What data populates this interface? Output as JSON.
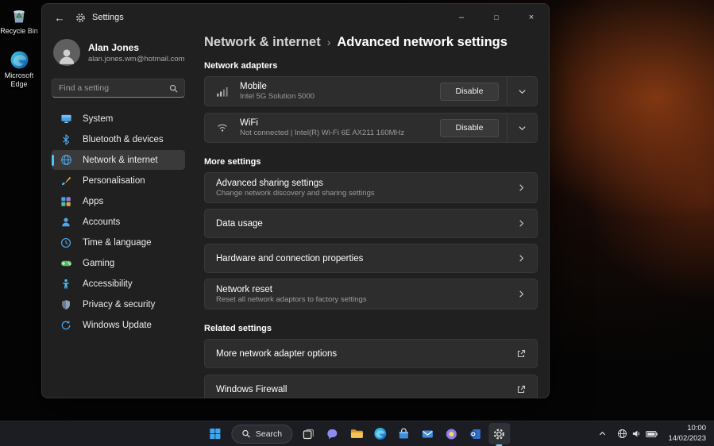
{
  "desktop": {
    "icons": [
      {
        "label": "Recycle Bin"
      },
      {
        "label": "Microsoft Edge"
      }
    ]
  },
  "titlebar": {
    "back_glyph": "←",
    "title": "Settings",
    "controls": {
      "minimize": "–",
      "maximize": "□",
      "close": "×"
    }
  },
  "profile": {
    "name": "Alan Jones",
    "email": "alan.jones.wm@hotmail.com"
  },
  "search": {
    "placeholder": "Find a setting"
  },
  "sidebar": {
    "items": [
      {
        "label": "System"
      },
      {
        "label": "Bluetooth & devices"
      },
      {
        "label": "Network & internet"
      },
      {
        "label": "Personalisation"
      },
      {
        "label": "Apps"
      },
      {
        "label": "Accounts"
      },
      {
        "label": "Time & language"
      },
      {
        "label": "Gaming"
      },
      {
        "label": "Accessibility"
      },
      {
        "label": "Privacy & security"
      },
      {
        "label": "Windows Update"
      }
    ]
  },
  "breadcrumb": {
    "parent": "Network & internet",
    "separator": "›",
    "current": "Advanced network settings"
  },
  "network_adapters": {
    "title": "Network adapters",
    "items": [
      {
        "title": "Mobile",
        "subtitle": "Intel 5G Solution 5000",
        "action": "Disable"
      },
      {
        "title": "WiFi",
        "subtitle": "Not connected | Intel(R) Wi-Fi 6E AX211 160MHz",
        "action": "Disable"
      }
    ]
  },
  "more_settings": {
    "title": "More settings",
    "items": [
      {
        "title": "Advanced sharing settings",
        "subtitle": "Change network discovery and sharing settings"
      },
      {
        "title": "Data usage"
      },
      {
        "title": "Hardware and connection properties"
      },
      {
        "title": "Network reset",
        "subtitle": "Reset all network adaptors to factory settings"
      }
    ]
  },
  "related_settings": {
    "title": "Related settings",
    "items": [
      {
        "title": "More network adapter options"
      },
      {
        "title": "Windows Firewall"
      }
    ]
  },
  "taskbar": {
    "search_label": "Search",
    "clock": {
      "time": "10:00",
      "date": "14/02/2023"
    }
  },
  "colors": {
    "accent": "#4cc2ff",
    "window_bg": "#202020",
    "card_bg": "#2d2d2d"
  }
}
